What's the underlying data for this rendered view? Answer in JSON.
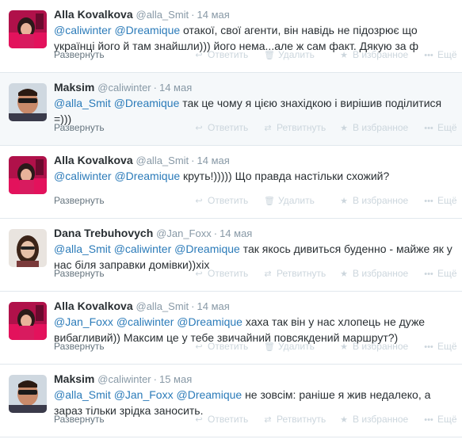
{
  "actions": {
    "expand": "Развернуть",
    "reply": "Ответить",
    "delete": "Удалить",
    "retweet": "Ретвитнуть",
    "favorite": "В избранное",
    "more": "Ещё"
  },
  "tweets": [
    {
      "fullname": "Alla Kovalkova",
      "username": "@alla_Smit",
      "time": "14 мая",
      "mentions": [
        "@caliwinter",
        "@Dreamique"
      ],
      "text": "отакої, свої агенти, він навідь не підозрює що українці його й там знайшли))) його нема...але ж сам факт. Дякую за ф",
      "avatar": "alla-avatar"
    },
    {
      "fullname": "Maksim",
      "username": "@caliwinter",
      "time": "14 мая",
      "mentions": [
        "@alla_Smit",
        "@Dreamique"
      ],
      "text": "так це чому я цією знахідкою і вирішив поділитися =)))",
      "avatar": "maksim-avatar"
    },
    {
      "fullname": "Alla Kovalkova",
      "username": "@alla_Smit",
      "time": "14 мая",
      "mentions": [
        "@caliwinter",
        "@Dreamique"
      ],
      "text": "круть!))))) Що правда настільки схожий?",
      "avatar": "alla-avatar"
    },
    {
      "fullname": "Dana Trebuhovych",
      "username": "@Jan_Foxx",
      "time": "14 мая",
      "mentions": [
        "@alla_Smit",
        "@caliwinter",
        "@Dreamique"
      ],
      "text": "так якось дивиться буденно - майже як у нас біля заправки домівки))хіх",
      "avatar": "dana-avatar"
    },
    {
      "fullname": "Alla Kovalkova",
      "username": "@alla_Smit",
      "time": "14 мая",
      "mentions": [
        "@Jan_Foxx",
        "@caliwinter",
        "@Dreamique"
      ],
      "text": "хаха  так він у нас хлопець не дуже вибагливий)) Максим це у тебе звичайний повсякдений маршрут?)",
      "avatar": "alla-avatar"
    },
    {
      "fullname": "Maksim",
      "username": "@caliwinter",
      "time": "15 мая",
      "mentions": [
        "@alla_Smit",
        "@Jan_Foxx",
        "@Dreamique"
      ],
      "text": "не зовсім: раніше я жив недалеко, а зараз тільки зрідка заносить.",
      "avatar": "maksim-avatar"
    }
  ],
  "colors": {
    "link": "#2b7bb9",
    "meta": "#8899a6",
    "action": "#ccd6dd",
    "alt_bg": "#f5f8fa",
    "border": "#e1e8ed"
  }
}
